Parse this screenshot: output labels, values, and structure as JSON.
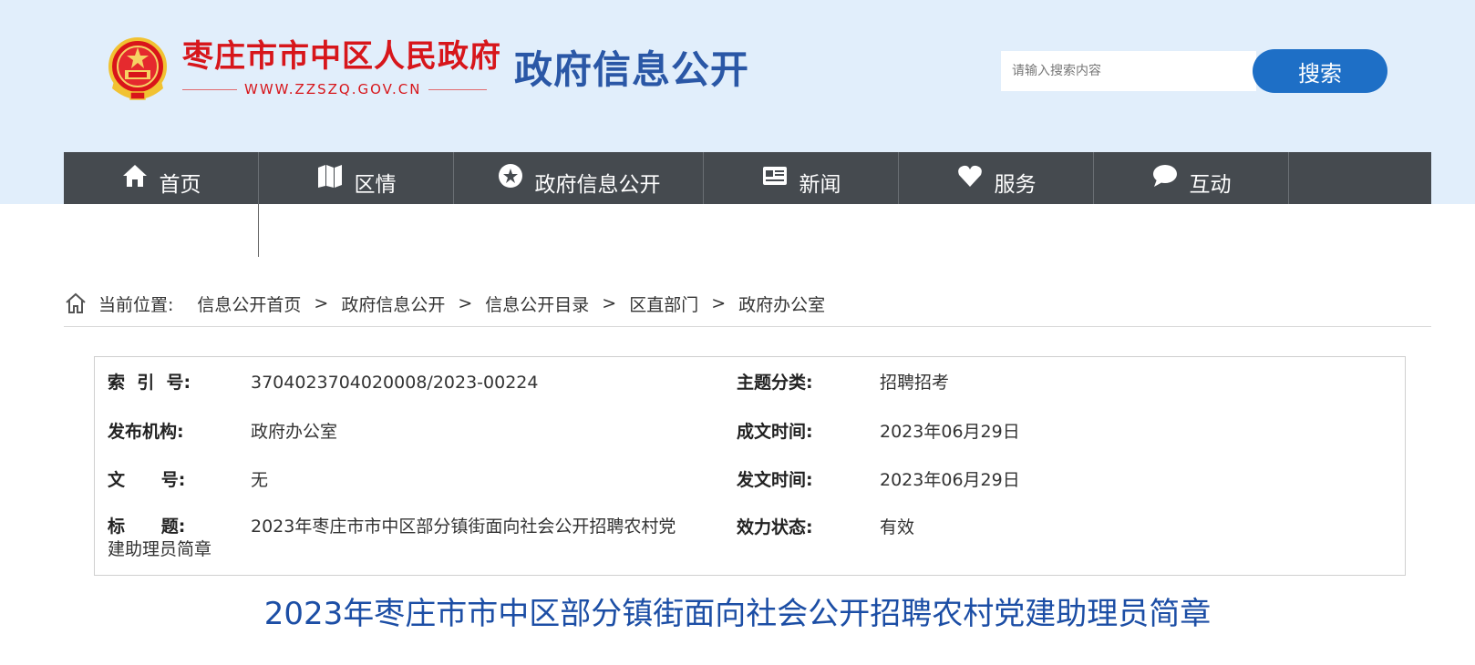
{
  "header": {
    "site_name": "枣庄市市中区人民政府",
    "site_url": "WWW.ZZSZQ.GOV.CN",
    "portal_title": "政府信息公开",
    "search": {
      "placeholder": "请输入搜索内容",
      "button_label": "搜索"
    }
  },
  "nav": {
    "items": [
      {
        "label": "首页",
        "icon": "home-icon"
      },
      {
        "label": "区情",
        "icon": "map-icon"
      },
      {
        "label": "政府信息公开",
        "icon": "badge-icon"
      },
      {
        "label": "新闻",
        "icon": "id-card-icon"
      },
      {
        "label": "服务",
        "icon": "heart-icon"
      },
      {
        "label": "互动",
        "icon": "chat-bubble-icon"
      }
    ]
  },
  "breadcrumb": {
    "prefix": "当前位置:",
    "separator": ">",
    "items": [
      "信息公开首页",
      "政府信息公开",
      "信息公开目录",
      "区直部门",
      "政府办公室"
    ]
  },
  "meta": {
    "index_no_label": "索  引  号:",
    "index_no": "3704023704020008/2023-00224",
    "topic_label": "主题分类:",
    "topic": "招聘招考",
    "publisher_label": "发布机构:",
    "publisher": "政府办公室",
    "created_label": "成文时间:",
    "created": "2023年06月29日",
    "doc_no_label": "文      号:",
    "doc_no": "无",
    "issued_label": "发文时间:",
    "issued": "2023年06月29日",
    "title_label": "标      题:",
    "title_line1": "2023年枣庄市市中区部分镇街面向社会公开招聘农村党",
    "title_line2": "建助理员简章",
    "status_label": "效力状态:",
    "status": "有效"
  },
  "document": {
    "title": "2023年枣庄市市中区部分镇街面向社会公开招聘农村党建助理员简章"
  },
  "colors": {
    "header_bg": "#e1eefb",
    "brand_red": "#d7161b",
    "portal_blue": "#2a57a6",
    "search_button": "#1e6fc6",
    "nav_bg": "#454a4f",
    "doc_title": "#1c4ea5"
  }
}
